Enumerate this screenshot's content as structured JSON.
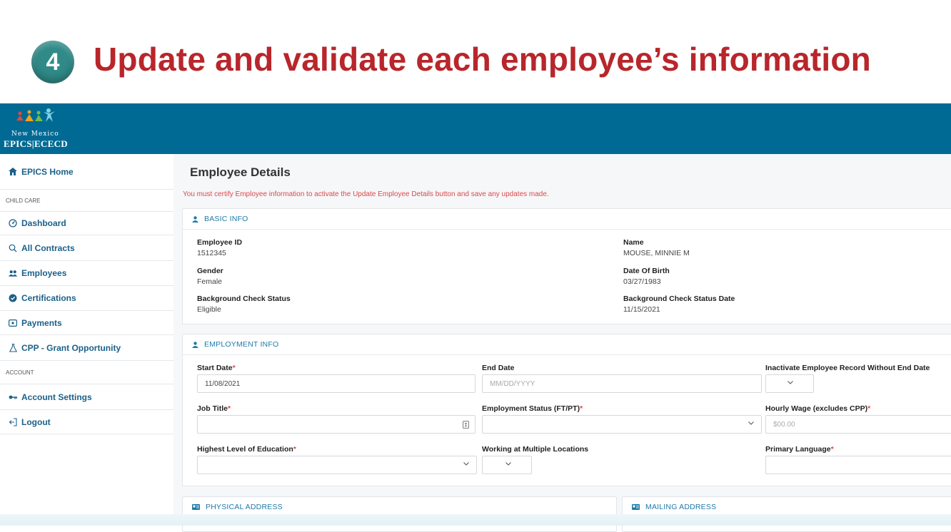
{
  "banner": {
    "step": "4",
    "title": "Update and validate each employee’s information"
  },
  "header": {
    "logo_sub": "New Mexico",
    "logo_main": "EPICS|ECECD"
  },
  "sidebar": {
    "home": "EPICS Home",
    "section_child_care": "CHILD CARE",
    "items": [
      {
        "label": "Dashboard",
        "icon": "dashboard-icon"
      },
      {
        "label": "All Contracts",
        "icon": "search-icon"
      },
      {
        "label": "Employees",
        "icon": "people-icon"
      },
      {
        "label": "Certifications",
        "icon": "certificate-icon"
      },
      {
        "label": "Payments",
        "icon": "payments-icon"
      },
      {
        "label": "CPP - Grant Opportunity",
        "icon": "flask-icon"
      }
    ],
    "section_account": "ACCOUNT",
    "account_items": [
      {
        "label": "Account Settings",
        "icon": "key-icon"
      },
      {
        "label": "Logout",
        "icon": "logout-icon"
      }
    ]
  },
  "main": {
    "title": "Employee Details",
    "warning": "You must certify Employee information to activate the Update Employee Details button and save any updates made."
  },
  "basic_info": {
    "heading": "BASIC INFO",
    "employee_id_label": "Employee ID",
    "employee_id": "1512345",
    "name_label": "Name",
    "name": "MOUSE, MINNIE M",
    "gender_label": "Gender",
    "gender": "Female",
    "dob_label": "Date Of Birth",
    "dob": "03/27/1983",
    "bg_status_label": "Background Check Status",
    "bg_status": "Eligible",
    "bg_date_label": "Background Check Status Date",
    "bg_date": "11/15/2021"
  },
  "employment_info": {
    "heading": "EMPLOYMENT INFO",
    "start_date_label": "Start Date",
    "start_date": "11/08/2021",
    "end_date_label": "End Date",
    "end_date_placeholder": "MM/DD/YYYY",
    "inactivate_label": "Inactivate Employee Record Without End Date",
    "job_title_label": "Job Title",
    "emp_status_label": "Employment Status (FT/PT)",
    "wage_label": "Hourly Wage (excludes CPP)",
    "wage_placeholder": "$00.00",
    "education_label": "Highest Level of Education",
    "multi_loc_label": "Working at Multiple Locations",
    "language_label": "Primary Language",
    "required_mark": "*"
  },
  "physical_address": {
    "heading": "PHYSICAL ADDRESS"
  },
  "mailing_address": {
    "heading": "MAILING ADDRESS"
  },
  "colors": {
    "header": "#006a94",
    "banner_title": "#b8262b",
    "step_badge": "#2f8a88",
    "nav_text": "#1c6089",
    "warning": "#d94a4a"
  }
}
